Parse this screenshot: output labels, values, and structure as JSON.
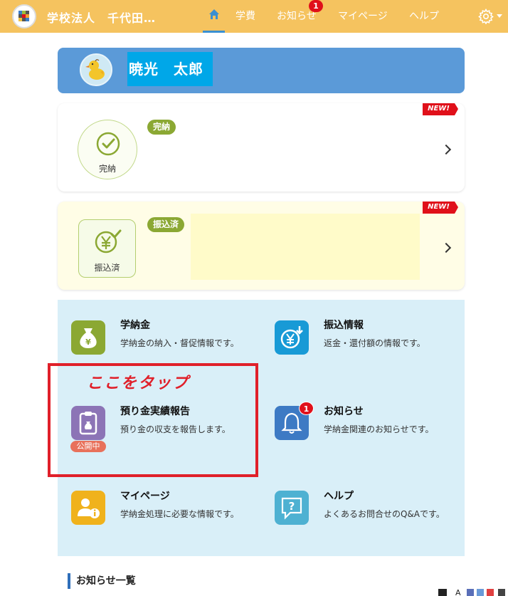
{
  "header": {
    "org_name": "学校法人　千代田…",
    "nav": {
      "fees": "学費",
      "news": "お知らせ",
      "news_badge": "1",
      "mypage": "マイページ",
      "help": "ヘルプ"
    }
  },
  "user": {
    "name": "暁光　太郎"
  },
  "status_cards": [
    {
      "ribbon": "NEW!",
      "icon_label": "完納",
      "pill": "完納"
    },
    {
      "ribbon": "NEW!",
      "icon_label": "振込済",
      "pill": "振込済"
    }
  ],
  "menu": {
    "tuition": {
      "title": "学納金",
      "desc": "学納金の納入・督促情報です。"
    },
    "transfer": {
      "title": "振込情報",
      "desc": "返金・還付額の情報です。"
    },
    "deposit": {
      "title": "預り金実績報告",
      "desc": "預り金の収支を報告します。",
      "badge": "公開中"
    },
    "notice": {
      "title": "お知らせ",
      "desc": "学納金関連のお知らせです。",
      "badge": "1"
    },
    "mypage": {
      "title": "マイページ",
      "desc": "学納金処理に必要な情報です。"
    },
    "help": {
      "title": "ヘルプ",
      "desc": "よくあるお問合せのQ&Aです。"
    }
  },
  "annotation": {
    "text": "ここをタップ"
  },
  "notice_list": {
    "title": "お知らせ一覧"
  },
  "colors": {
    "header": "#f5c35f",
    "banner": "#5b9ad8",
    "pill": "#8ba833",
    "badge_red": "#e0101a",
    "annotation_red": "#e0202a",
    "grid_bg": "#d9eff8"
  }
}
